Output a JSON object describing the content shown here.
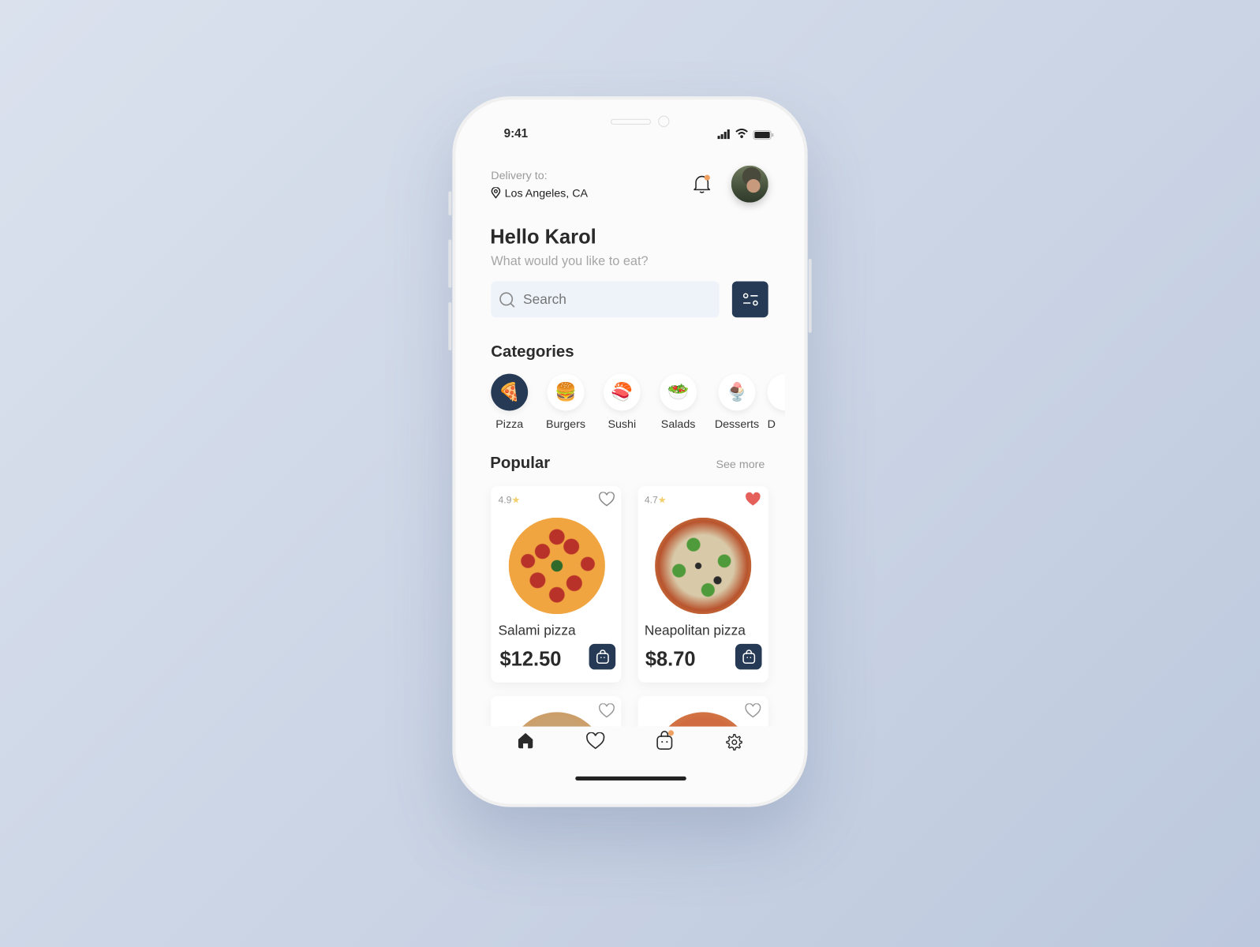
{
  "status_bar": {
    "time": "9:41"
  },
  "header": {
    "delivery_label": "Delivery to:",
    "location": "Los Angeles, CA",
    "notification_dot_color": "#f0a060"
  },
  "greeting": {
    "title": "Hello Karol",
    "subtitle": "What would you like to eat?"
  },
  "search": {
    "placeholder": "Search"
  },
  "colors": {
    "accent": "#273a55",
    "search_bg": "#eef3fa",
    "favorite": "#e5605a",
    "star": "#f2cf6c"
  },
  "categories": {
    "title": "Categories",
    "items": [
      {
        "label": "Pizza",
        "icon": "🍕",
        "selected": true
      },
      {
        "label": "Burgers",
        "icon": "🍔"
      },
      {
        "label": "Sushi",
        "icon": "🍣"
      },
      {
        "label": "Salads",
        "icon": "🥗"
      },
      {
        "label": "Desserts",
        "icon": "🍨"
      },
      {
        "label": "D",
        "icon": ""
      }
    ]
  },
  "popular": {
    "title": "Popular",
    "see_more": "See more",
    "items": [
      {
        "rating": "4.9",
        "name": "Salami pizza",
        "price": "$12.50",
        "favorite": false
      },
      {
        "rating": "4.7",
        "name": "Neapolitan pizza",
        "price": "$8.70",
        "favorite": true
      }
    ]
  },
  "bottom_nav": {
    "items": [
      "home",
      "favorites",
      "cart",
      "settings"
    ],
    "active": "home"
  }
}
